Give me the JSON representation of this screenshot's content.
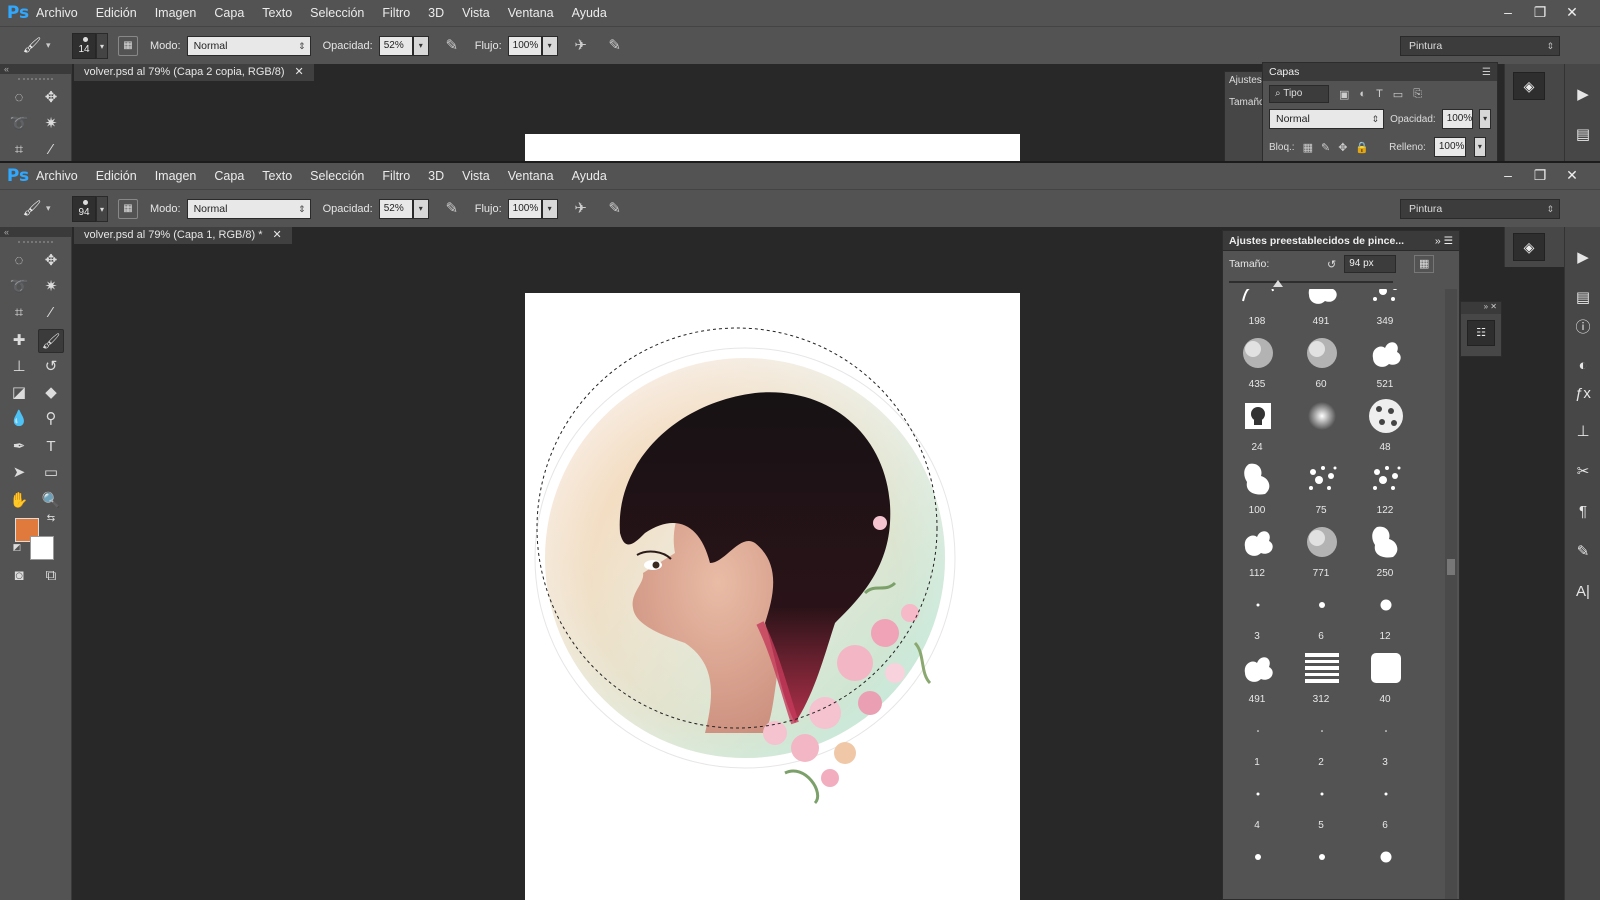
{
  "menu": [
    "Archivo",
    "Edición",
    "Imagen",
    "Capa",
    "Texto",
    "Selección",
    "Filtro",
    "3D",
    "Vista",
    "Ventana",
    "Ayuda"
  ],
  "app_logo": "Ps",
  "window_controls": [
    "minimize-icon",
    "restore-icon",
    "close-icon"
  ],
  "options": {
    "modo_label": "Modo:",
    "modo_value": "Normal",
    "opacidad_label": "Opacidad:",
    "opacidad_value": "52%",
    "flujo_label": "Flujo:",
    "flujo_value": "100%",
    "workspace": "Pintura"
  },
  "windows": [
    {
      "brush_size": "14",
      "doc_tab": "volver.psd al 79% (Capa 2 copia, RGB/8)",
      "layers_panel": {
        "adjust_tab": "Ajustes",
        "title": "Capas",
        "size_label": "Tamaño",
        "filter_kind": "Tipo",
        "blend_mode": "Normal",
        "opacity_label": "Opacidad:",
        "opacity_value": "100%",
        "lock_label": "Bloq.:",
        "fill_label": "Relleno:",
        "fill_value": "100%"
      }
    },
    {
      "brush_size": "94",
      "doc_tab": "volver.psd al 79% (Capa 1, RGB/8) *",
      "brush_presets": {
        "title": "Ajustes preestablecidos de pince...",
        "size_label": "Tamaño:",
        "size_value": "94 px",
        "size_fraction": 0.3,
        "brushes": [
          {
            "n": "198",
            "kind": "scribble"
          },
          {
            "n": "491",
            "kind": "splat"
          },
          {
            "n": "349",
            "kind": "spray"
          },
          {
            "n": "435",
            "kind": "smoke"
          },
          {
            "n": "60",
            "kind": "smoke"
          },
          {
            "n": "521",
            "kind": "splat"
          },
          {
            "n": "24",
            "kind": "skull"
          },
          {
            "n": "",
            "kind": "soft"
          },
          {
            "n": "48",
            "kind": "leopard"
          },
          {
            "n": "100",
            "kind": "blot"
          },
          {
            "n": "75",
            "kind": "spray"
          },
          {
            "n": "122",
            "kind": "spray"
          },
          {
            "n": "112",
            "kind": "splat"
          },
          {
            "n": "771",
            "kind": "smoke"
          },
          {
            "n": "250",
            "kind": "blot"
          },
          {
            "n": "3",
            "kind": "dot-s"
          },
          {
            "n": "6",
            "kind": "dot-m"
          },
          {
            "n": "12",
            "kind": "dot-l"
          },
          {
            "n": "491",
            "kind": "splat"
          },
          {
            "n": "312",
            "kind": "lines"
          },
          {
            "n": "40",
            "kind": "square"
          },
          {
            "n": "1",
            "kind": "dot-xs"
          },
          {
            "n": "2",
            "kind": "dot-xs"
          },
          {
            "n": "3",
            "kind": "dot-xs"
          },
          {
            "n": "4",
            "kind": "dot-s"
          },
          {
            "n": "5",
            "kind": "dot-s"
          },
          {
            "n": "6",
            "kind": "dot-s"
          },
          {
            "n": "",
            "kind": "dot-m"
          },
          {
            "n": "",
            "kind": "dot-m"
          },
          {
            "n": "",
            "kind": "dot-l"
          }
        ]
      }
    }
  ],
  "foreground_color": "#e07a3c",
  "background_color": "#ffffff"
}
